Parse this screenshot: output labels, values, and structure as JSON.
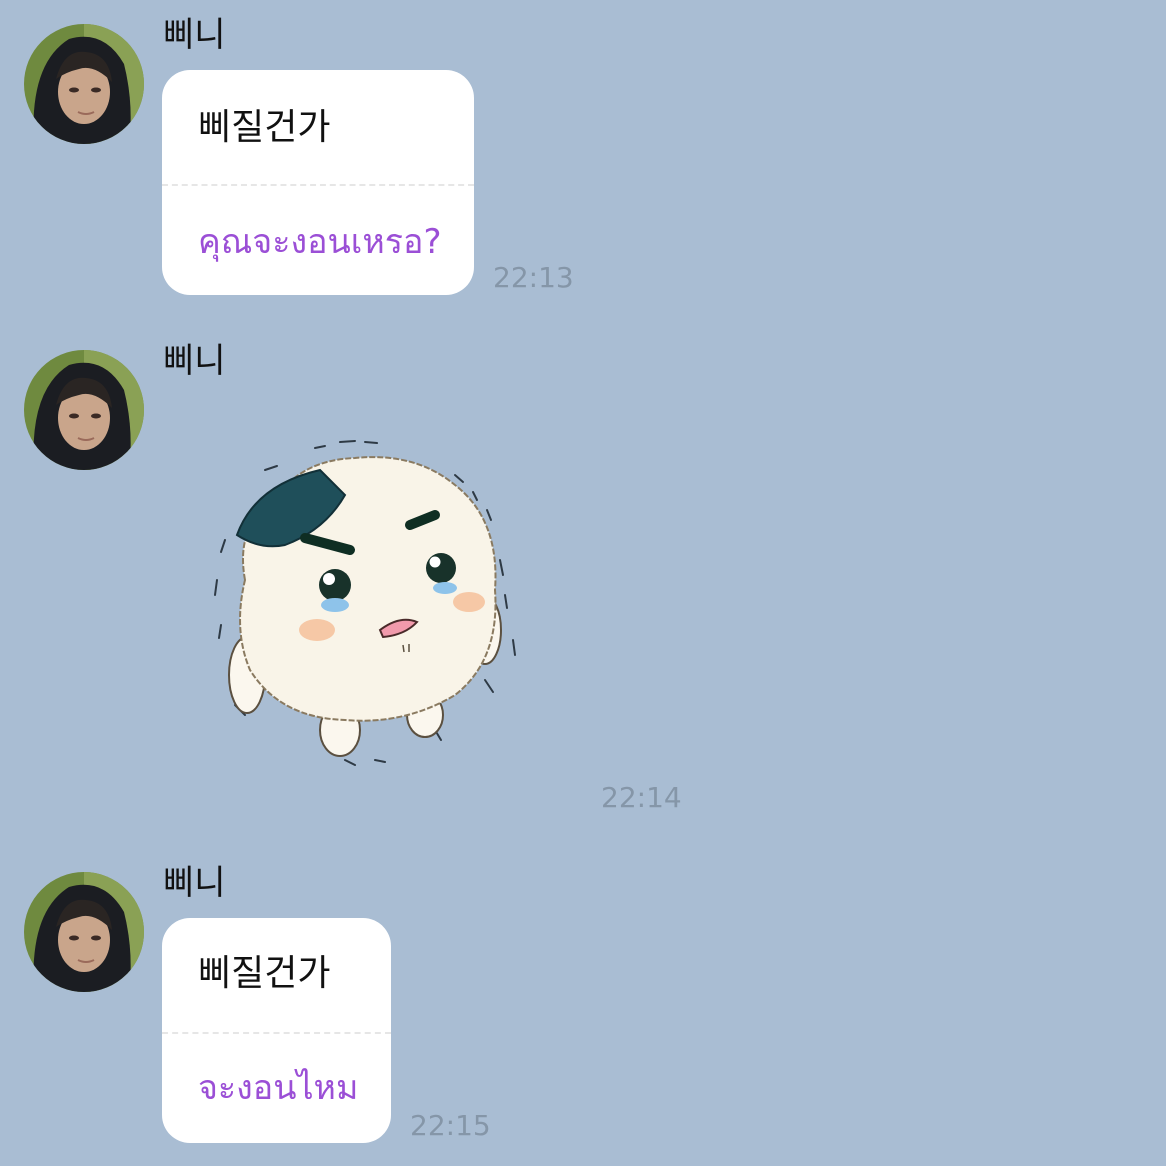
{
  "messages": [
    {
      "sender": "삐니",
      "korean": "삐질건가",
      "thai": "คุณจะงอนเหรอ?",
      "time": "22:13"
    },
    {
      "sender": "삐니",
      "sticker": "crying-rice-ball-sticker",
      "time": "22:14"
    },
    {
      "sender": "삐니",
      "korean": "삐질건가",
      "thai": "จะงอนไหม",
      "time": "22:15"
    }
  ],
  "colors": {
    "background": "#a9bdd3",
    "bubble": "#ffffff",
    "translation_text": "#9b4fd6",
    "timestamp": "#8596a8"
  }
}
